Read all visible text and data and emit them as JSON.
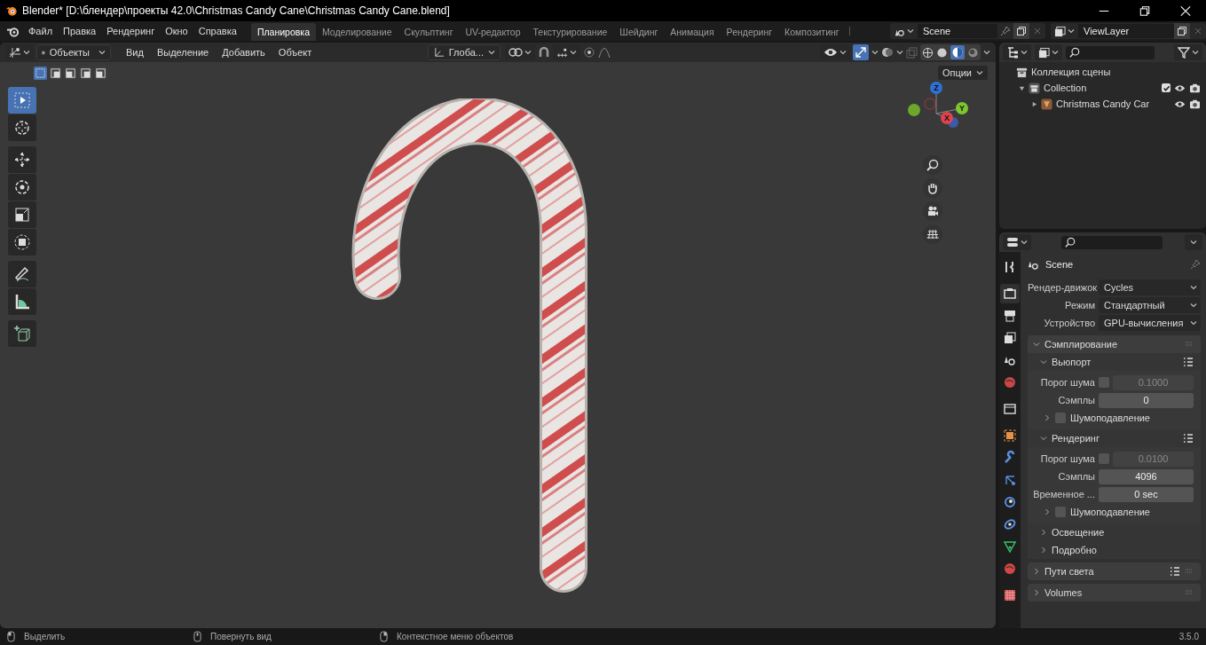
{
  "window": {
    "title": "Blender* [D:\\блендер\\проекты 42.0\\Christmas Candy Cane\\Christmas Candy Cane.blend]"
  },
  "menu": [
    "Файл",
    "Правка",
    "Рендеринг",
    "Окно",
    "Справка"
  ],
  "workspaces": [
    {
      "label": "Планировка",
      "selected": true
    },
    {
      "label": "Моделирование",
      "selected": false
    },
    {
      "label": "Скульптинг",
      "selected": false
    },
    {
      "label": "UV-редактор",
      "selected": false
    },
    {
      "label": "Текстурирование",
      "selected": false
    },
    {
      "label": "Шейдинг",
      "selected": false
    },
    {
      "label": "Анимация",
      "selected": false
    },
    {
      "label": "Рендеринг",
      "selected": false
    },
    {
      "label": "Композитинг",
      "selected": false
    }
  ],
  "scene": "Scene",
  "view_layer": "ViewLayer",
  "viewport": {
    "mode": "Объекты",
    "menus": [
      "Вид",
      "Выделение",
      "Добавить",
      "Объект"
    ],
    "orientation": "Глоба...",
    "options": "Опции",
    "select_modes": [
      {
        "selected": true
      },
      {
        "selected": false
      },
      {
        "selected": false
      },
      {
        "selected": false
      },
      {
        "selected": false
      }
    ],
    "tools": [
      {
        "kind": "select",
        "selected": true
      },
      {
        "kind": "cursor",
        "selected": false
      },
      {
        "kind": "move",
        "selected": false
      },
      {
        "kind": "rotate",
        "selected": false
      },
      {
        "kind": "scale",
        "selected": false
      },
      {
        "kind": "transform",
        "selected": false
      },
      {
        "kind": "annotate",
        "selected": false
      },
      {
        "kind": "measure",
        "selected": false
      },
      {
        "kind": "add_cube",
        "selected": false
      }
    ],
    "gizmo": {
      "x": "X",
      "y": "Y",
      "z": "Z"
    }
  },
  "outliner": {
    "items": [
      {
        "kind": "scene_collection",
        "label": "Коллекция сцены",
        "children": [
          {
            "kind": "collection",
            "label": "Collection",
            "expanded": true,
            "checked": true,
            "children": [
              {
                "kind": "object",
                "label": "Christmas Candy Car",
                "expanded": false
              }
            ]
          }
        ]
      }
    ]
  },
  "properties": {
    "context": "Scene",
    "tabs": [
      {
        "kind": "tool",
        "selected": false
      },
      {
        "kind": "render",
        "selected": true
      },
      {
        "kind": "output",
        "selected": false
      },
      {
        "kind": "view_layer",
        "selected": false
      },
      {
        "kind": "scene",
        "selected": false
      },
      {
        "kind": "world",
        "selected": false
      },
      {
        "kind": "collection",
        "selected": false
      },
      {
        "kind": "object",
        "selected": false
      },
      {
        "kind": "modifier",
        "selected": false
      },
      {
        "kind": "particles",
        "selected": false
      },
      {
        "kind": "physics",
        "selected": false
      },
      {
        "kind": "constraints",
        "selected": false
      },
      {
        "kind": "data",
        "selected": false
      },
      {
        "kind": "material",
        "selected": false
      },
      {
        "kind": "texture",
        "selected": false
      }
    ],
    "fields": [
      {
        "label": "Рендер-движок",
        "value": "Cycles"
      },
      {
        "label": "Режим",
        "value": "Стандартный"
      },
      {
        "label": "Устройство",
        "value": "GPU-вычисления"
      }
    ],
    "panels": [
      {
        "label": "Сэмплирование",
        "expanded": true,
        "subpanels": [
          {
            "label": "Вьюпорт",
            "expanded": true,
            "rows": [
              {
                "kind": "threshold",
                "label": "Порог шума",
                "checked": false,
                "value": "0.1000"
              },
              {
                "kind": "number",
                "label": "Сэмплы",
                "value": "0"
              },
              {
                "kind": "subpanel",
                "label": "Шумоподавление",
                "checked": false
              }
            ]
          },
          {
            "label": "Рендеринг",
            "expanded": true,
            "rows": [
              {
                "kind": "threshold",
                "label": "Порог шума",
                "checked": false,
                "value": "0.0100"
              },
              {
                "kind": "number",
                "label": "Сэмплы",
                "value": "4096"
              },
              {
                "kind": "number",
                "label": "Временное ...",
                "value": "0 sec"
              },
              {
                "kind": "subpanel",
                "label": "Шумоподавление",
                "checked": false
              }
            ]
          },
          {
            "label": "Освещение",
            "expanded": false
          },
          {
            "label": "Подробно",
            "expanded": false
          }
        ]
      },
      {
        "label": "Пути света",
        "expanded": false
      },
      {
        "label": "Volumes",
        "expanded": false
      }
    ]
  },
  "status_bar": {
    "hints": [
      {
        "kind": "left_click",
        "label": "Выделить"
      },
      {
        "kind": "middle_click",
        "label": "Повернуть вид"
      },
      {
        "kind": "right_click",
        "label": "Контекстное меню объектов"
      }
    ],
    "version": "3.5.0"
  }
}
